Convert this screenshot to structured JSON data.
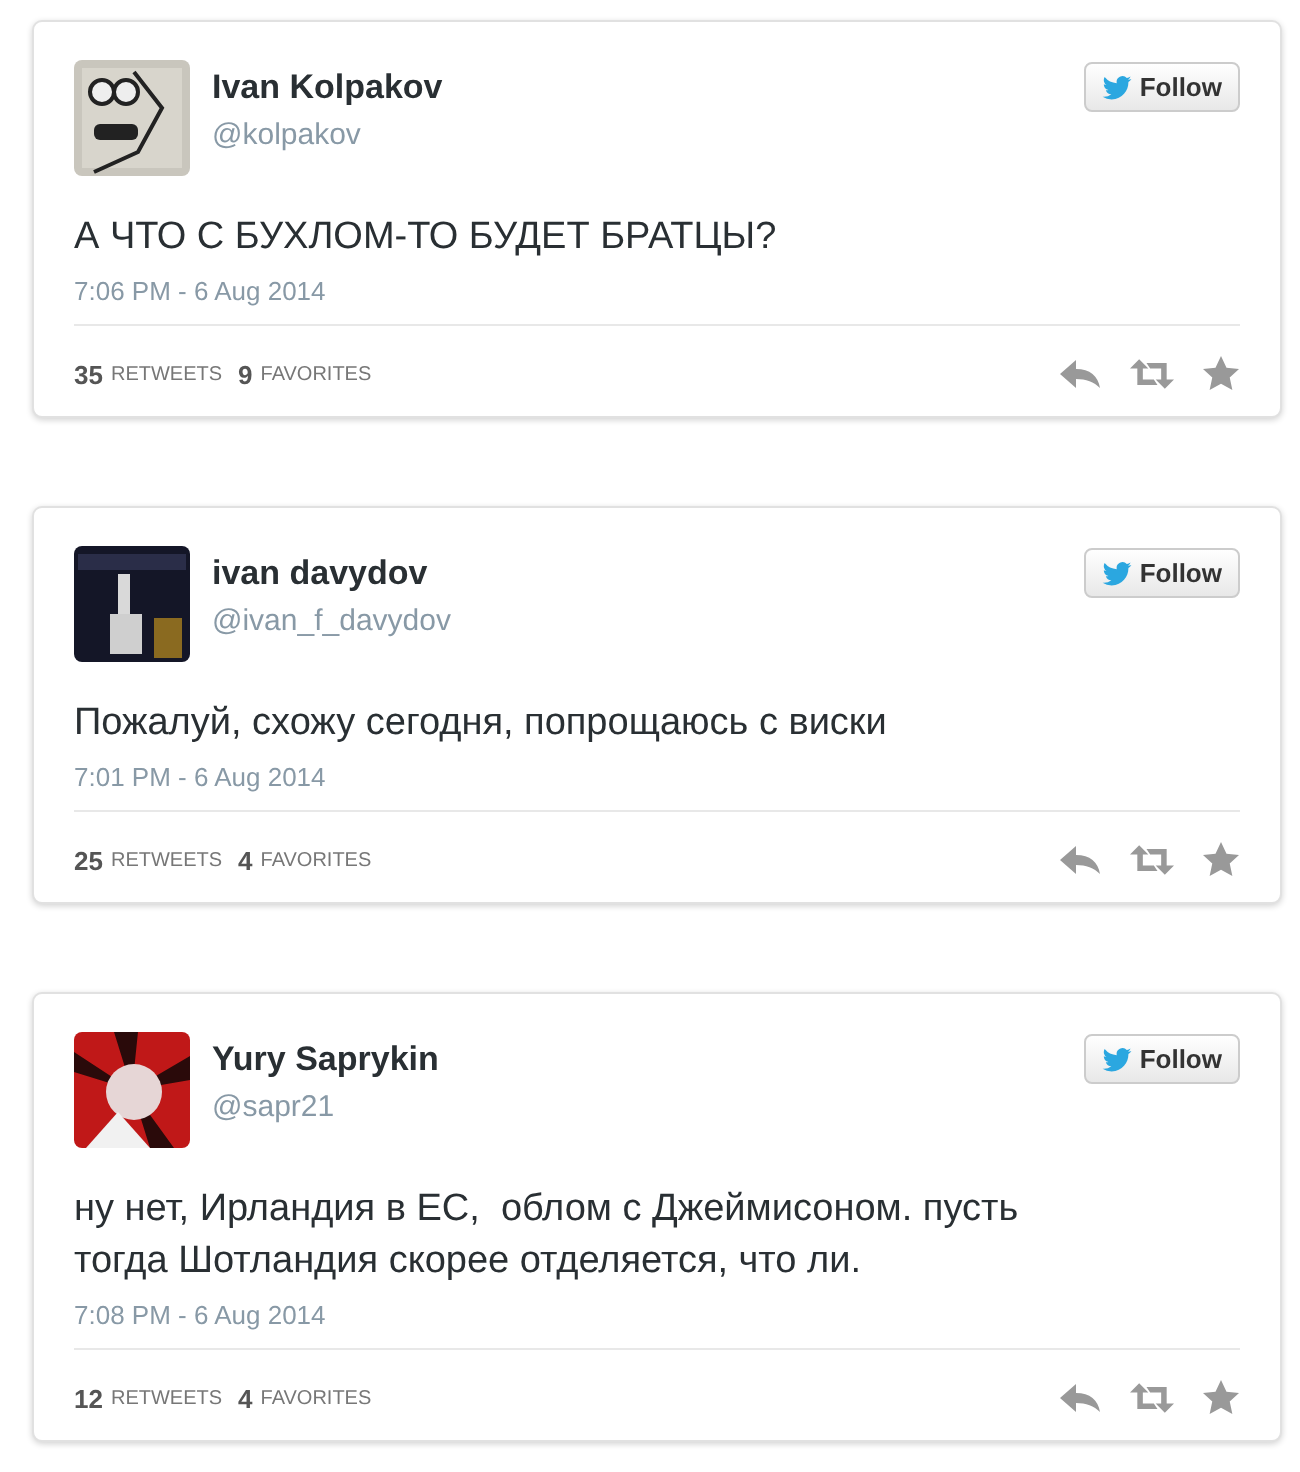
{
  "tweets": [
    {
      "name": "Ivan Kolpakov",
      "handle": "@kolpakov",
      "follow": "Follow",
      "text": "А ЧТО С БУХЛОМ-ТО БУДЕТ БРАТЦЫ?",
      "time": "7:06 PM - 6 Aug 2014",
      "retweets": "35",
      "retweets_label": "RETWEETS",
      "favorites": "9",
      "favorites_label": "FAVORITES"
    },
    {
      "name": "ivan davydov",
      "handle": "@ivan_f_davydov",
      "follow": "Follow",
      "text": "Пожалуй, схожу сегодня, попрощаюсь с виски",
      "time": "7:01 PM - 6 Aug 2014",
      "retweets": "25",
      "retweets_label": "RETWEETS",
      "favorites": "4",
      "favorites_label": "FAVORITES"
    },
    {
      "name": "Yury Saprykin",
      "handle": "@sapr21",
      "follow": "Follow",
      "text": "ну нет, Ирландия в ЕС,  облом с Джеймисоном. пусть\nтогда Шотландия скорее отделяется, что ли.",
      "time": "7:08 PM - 6 Aug 2014",
      "retweets": "12",
      "retweets_label": "RETWEETS",
      "favorites": "4",
      "favorites_label": "FAVORITES"
    }
  ]
}
